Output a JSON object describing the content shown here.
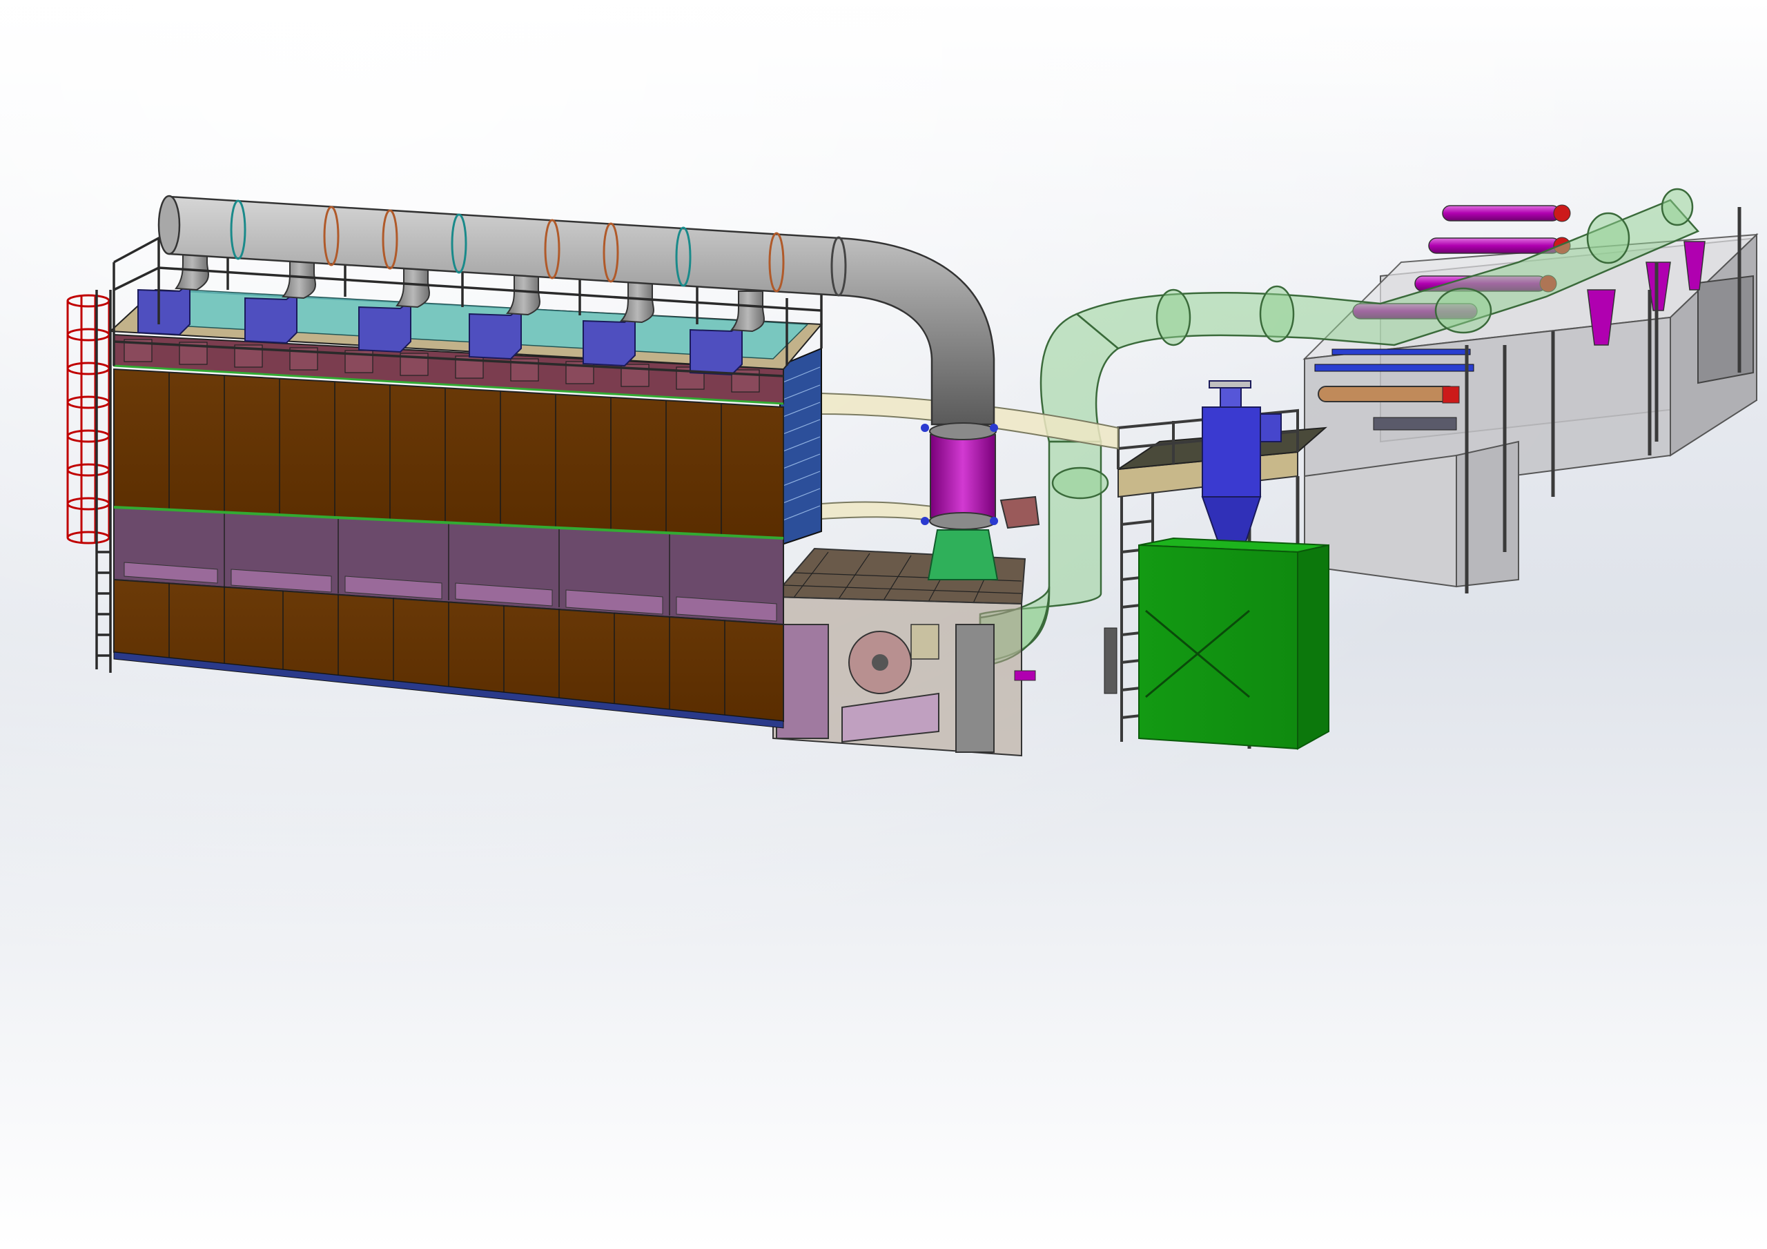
{
  "viewport": {
    "background_top": "#ffffff",
    "background_mid": "#e6e9ef",
    "background_horizon": "#dfe3ea",
    "background_bottom": "#ffffff"
  },
  "colors": {
    "filter_house_panel": "#663300",
    "filter_house_band": "#6b4a6b",
    "plenum_top": "#7b3d4f",
    "hood_box": "#4f4fbf",
    "hood_cyan": "#66cccc",
    "duct_grey": "#9a9a9a",
    "duct_magenta": "#b000b0",
    "duct_transparent_green": "#8fd08f",
    "cone_green": "#2fb05a",
    "fan_box": "#7a5a6a",
    "cyclone_blue": "#3a3ad0",
    "bin_green": "#15a015",
    "booth_grey": "#c8c8cc",
    "ladder_red": "#c00000",
    "beige_pipe": "#efe8c4",
    "steel": "#3a3a3a"
  },
  "components": [
    {
      "name": "baghouse-filter",
      "color": "filter_house_panel"
    },
    {
      "name": "main-exhaust-duct",
      "color": "duct_grey"
    },
    {
      "name": "transparent-transfer-duct",
      "color": "duct_transparent_green"
    },
    {
      "name": "cyclone-separator",
      "color": "cyclone_blue"
    },
    {
      "name": "collection-bin",
      "color": "bin_green"
    },
    {
      "name": "spray-booth-line",
      "color": "booth_grey"
    }
  ]
}
